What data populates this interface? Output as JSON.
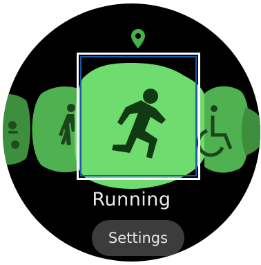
{
  "activity": {
    "selected_label": "Running"
  },
  "buttons": {
    "settings_label": "Settings"
  },
  "colors": {
    "active_green": "#6fdc6f",
    "dim_green": "#3d8e3d",
    "background": "#000000",
    "button_bg": "#3c3c3c",
    "selection_outline": "#1a5aa8"
  },
  "carousel": {
    "items": [
      {
        "icon": "cycling-icon"
      },
      {
        "icon": "walking-icon"
      },
      {
        "icon": "running-icon"
      },
      {
        "icon": "wheelchair-icon"
      },
      {
        "icon": "next-exercise-icon"
      }
    ]
  },
  "header": {
    "icon": "location-pin-icon"
  }
}
